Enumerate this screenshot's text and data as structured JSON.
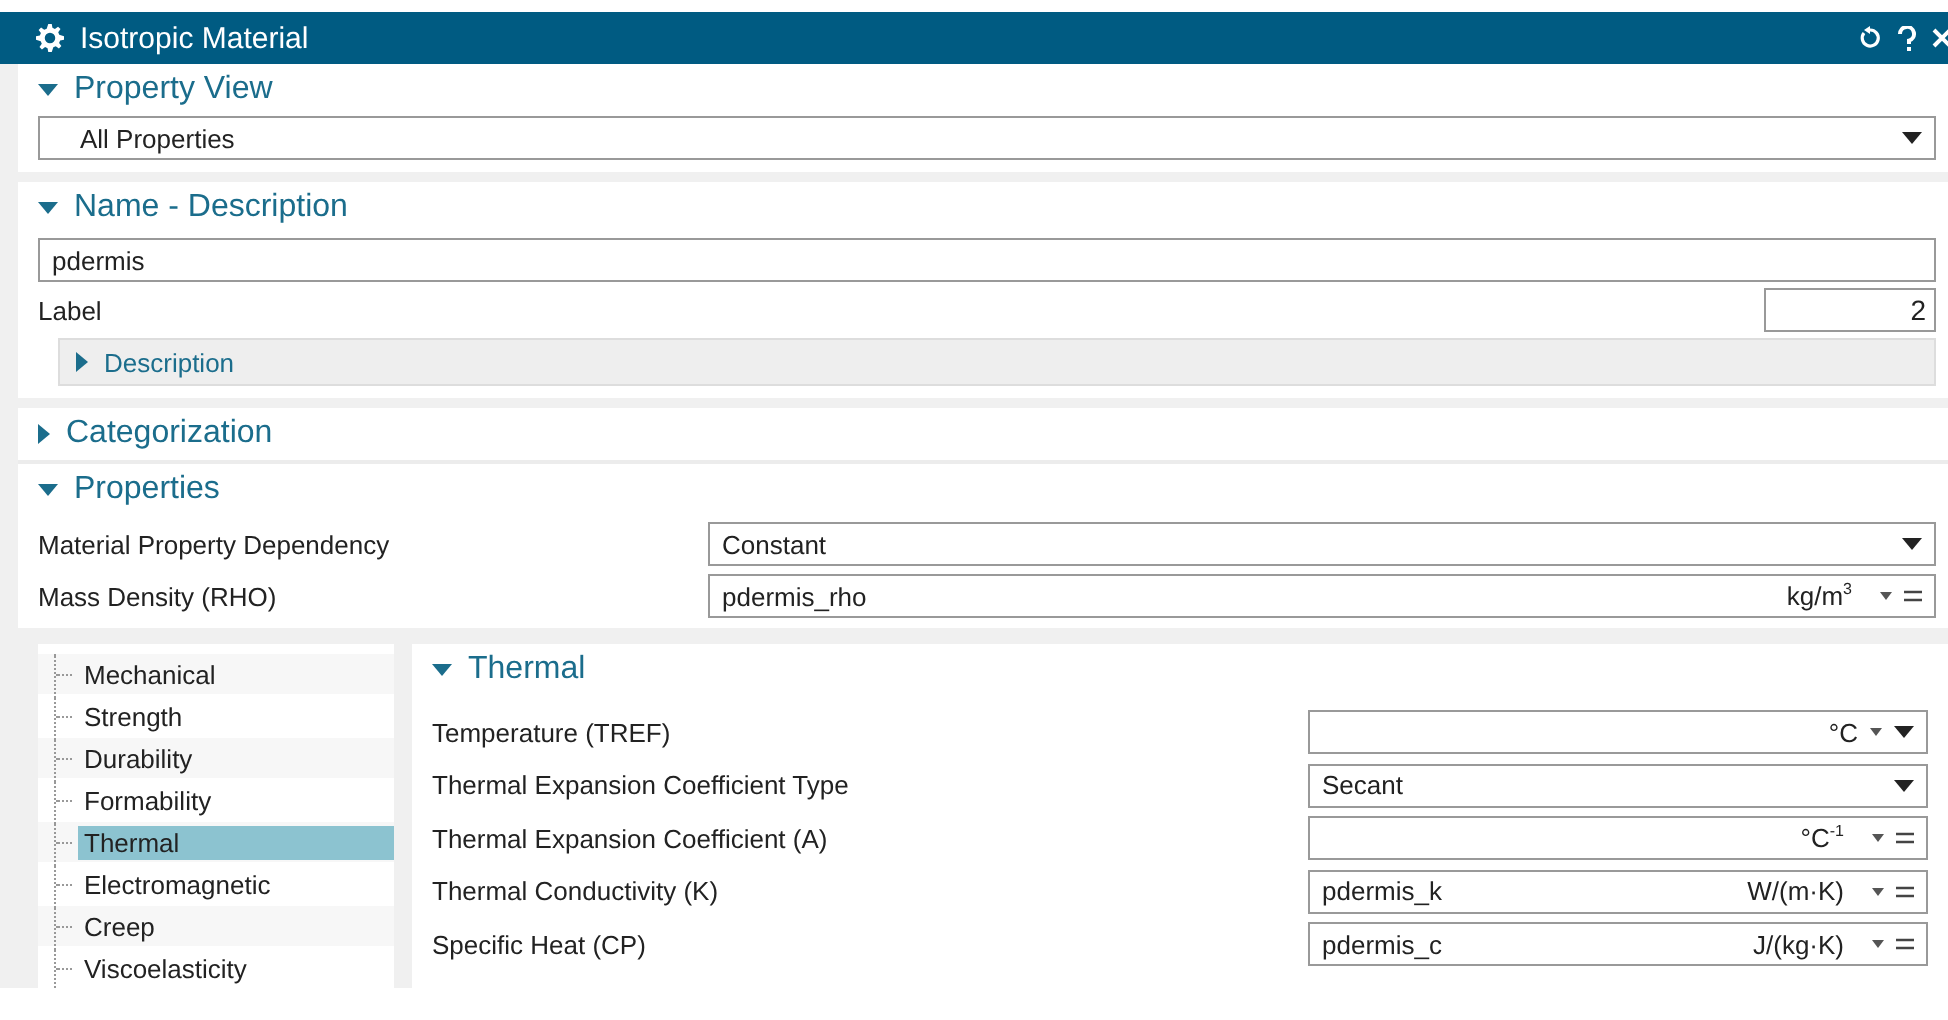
{
  "window": {
    "title": "Isotropic Material"
  },
  "property_view": {
    "title": "Property View",
    "expanded": true,
    "value": "All Properties"
  },
  "name_description": {
    "title": "Name - Description",
    "expanded": true,
    "name": "pdermis",
    "label": "Label",
    "label_value": "2",
    "description": {
      "title": "Description",
      "expanded": false
    }
  },
  "categorization": {
    "title": "Categorization",
    "expanded": false
  },
  "properties": {
    "title": "Properties",
    "expanded": true,
    "rows": [
      {
        "label": "Material Property Dependency",
        "kind": "dropdown",
        "value": "Constant"
      },
      {
        "label": "Mass Density (RHO)",
        "kind": "expression",
        "value": "pdermis_rho",
        "unit": "kg/m$^{3}$"
      }
    ]
  },
  "tree": [
    {
      "label": "Mechanical",
      "selected": false
    },
    {
      "label": "Strength",
      "selected": false
    },
    {
      "label": "Durability",
      "selected": false
    },
    {
      "label": "Formability",
      "selected": false
    },
    {
      "label": "Thermal",
      "selected": true
    },
    {
      "label": "Electromagnetic",
      "selected": false
    },
    {
      "label": "Creep",
      "selected": false
    },
    {
      "label": "Viscoelasticity",
      "selected": false
    }
  ],
  "thermal": {
    "title": "Thermal",
    "expanded": true,
    "rows": [
      {
        "label": "Temperature (TREF)",
        "kind": "unit_dropdown",
        "unit": "°C"
      },
      {
        "label": "Thermal Expansion Coefficient Type",
        "kind": "dropdown",
        "value": "Secant"
      },
      {
        "label": "Thermal Expansion Coefficient (A)",
        "kind": "expression",
        "unit": "°C$^{-1}$"
      },
      {
        "label": "Thermal Conductivity (K)",
        "kind": "expression",
        "value": "pdermis_k",
        "unit": "W/(m·K)"
      },
      {
        "label": "Specific Heat (CP)",
        "kind": "expression",
        "value": "pdermis_c",
        "unit": "J/(kg·K)"
      }
    ]
  }
}
